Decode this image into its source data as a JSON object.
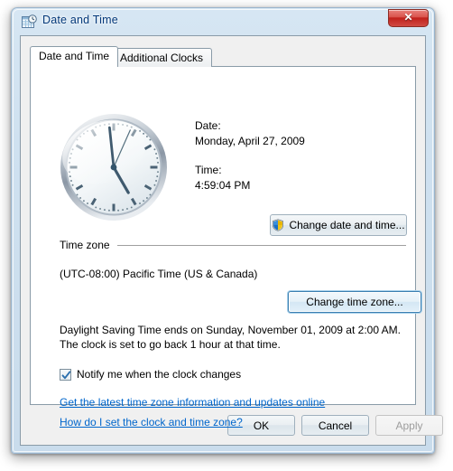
{
  "window": {
    "title": "Date and Time",
    "icon": "calendar-clock-icon",
    "close_label": "✕"
  },
  "tabs": [
    {
      "label": "Date and Time",
      "active": true
    },
    {
      "label": "Additional Clocks",
      "active": false
    }
  ],
  "main": {
    "clock": {
      "icon": "analog-clock",
      "hour": 4,
      "minute": 59,
      "second": 4
    },
    "date_label": "Date:",
    "date_value": "Monday, April 27, 2009",
    "time_label": "Time:",
    "time_value": "4:59:04 PM",
    "change_datetime_button": "Change date and time...",
    "change_datetime_icon": "uac-shield-icon",
    "timezone_group_title": "Time zone",
    "timezone_value": "(UTC-08:00) Pacific Time (US & Canada)",
    "change_timezone_button": "Change time zone...",
    "dst_text": "Daylight Saving Time ends on Sunday, November 01, 2009 at 2:00 AM. The clock is set to go back 1 hour at that time.",
    "notify_checkbox_label": "Notify me when the clock changes",
    "notify_checkbox_checked": true,
    "link_update_online": "Get the latest time zone information and updates online",
    "link_help": "How do I set the clock and time zone?"
  },
  "footer": {
    "ok": "OK",
    "cancel": "Cancel",
    "apply": "Apply",
    "apply_disabled": true
  },
  "colors": {
    "link": "#0066cc",
    "title_text": "#04397a",
    "close_button": "#c0201a",
    "focus_border": "#3c7fb1"
  }
}
